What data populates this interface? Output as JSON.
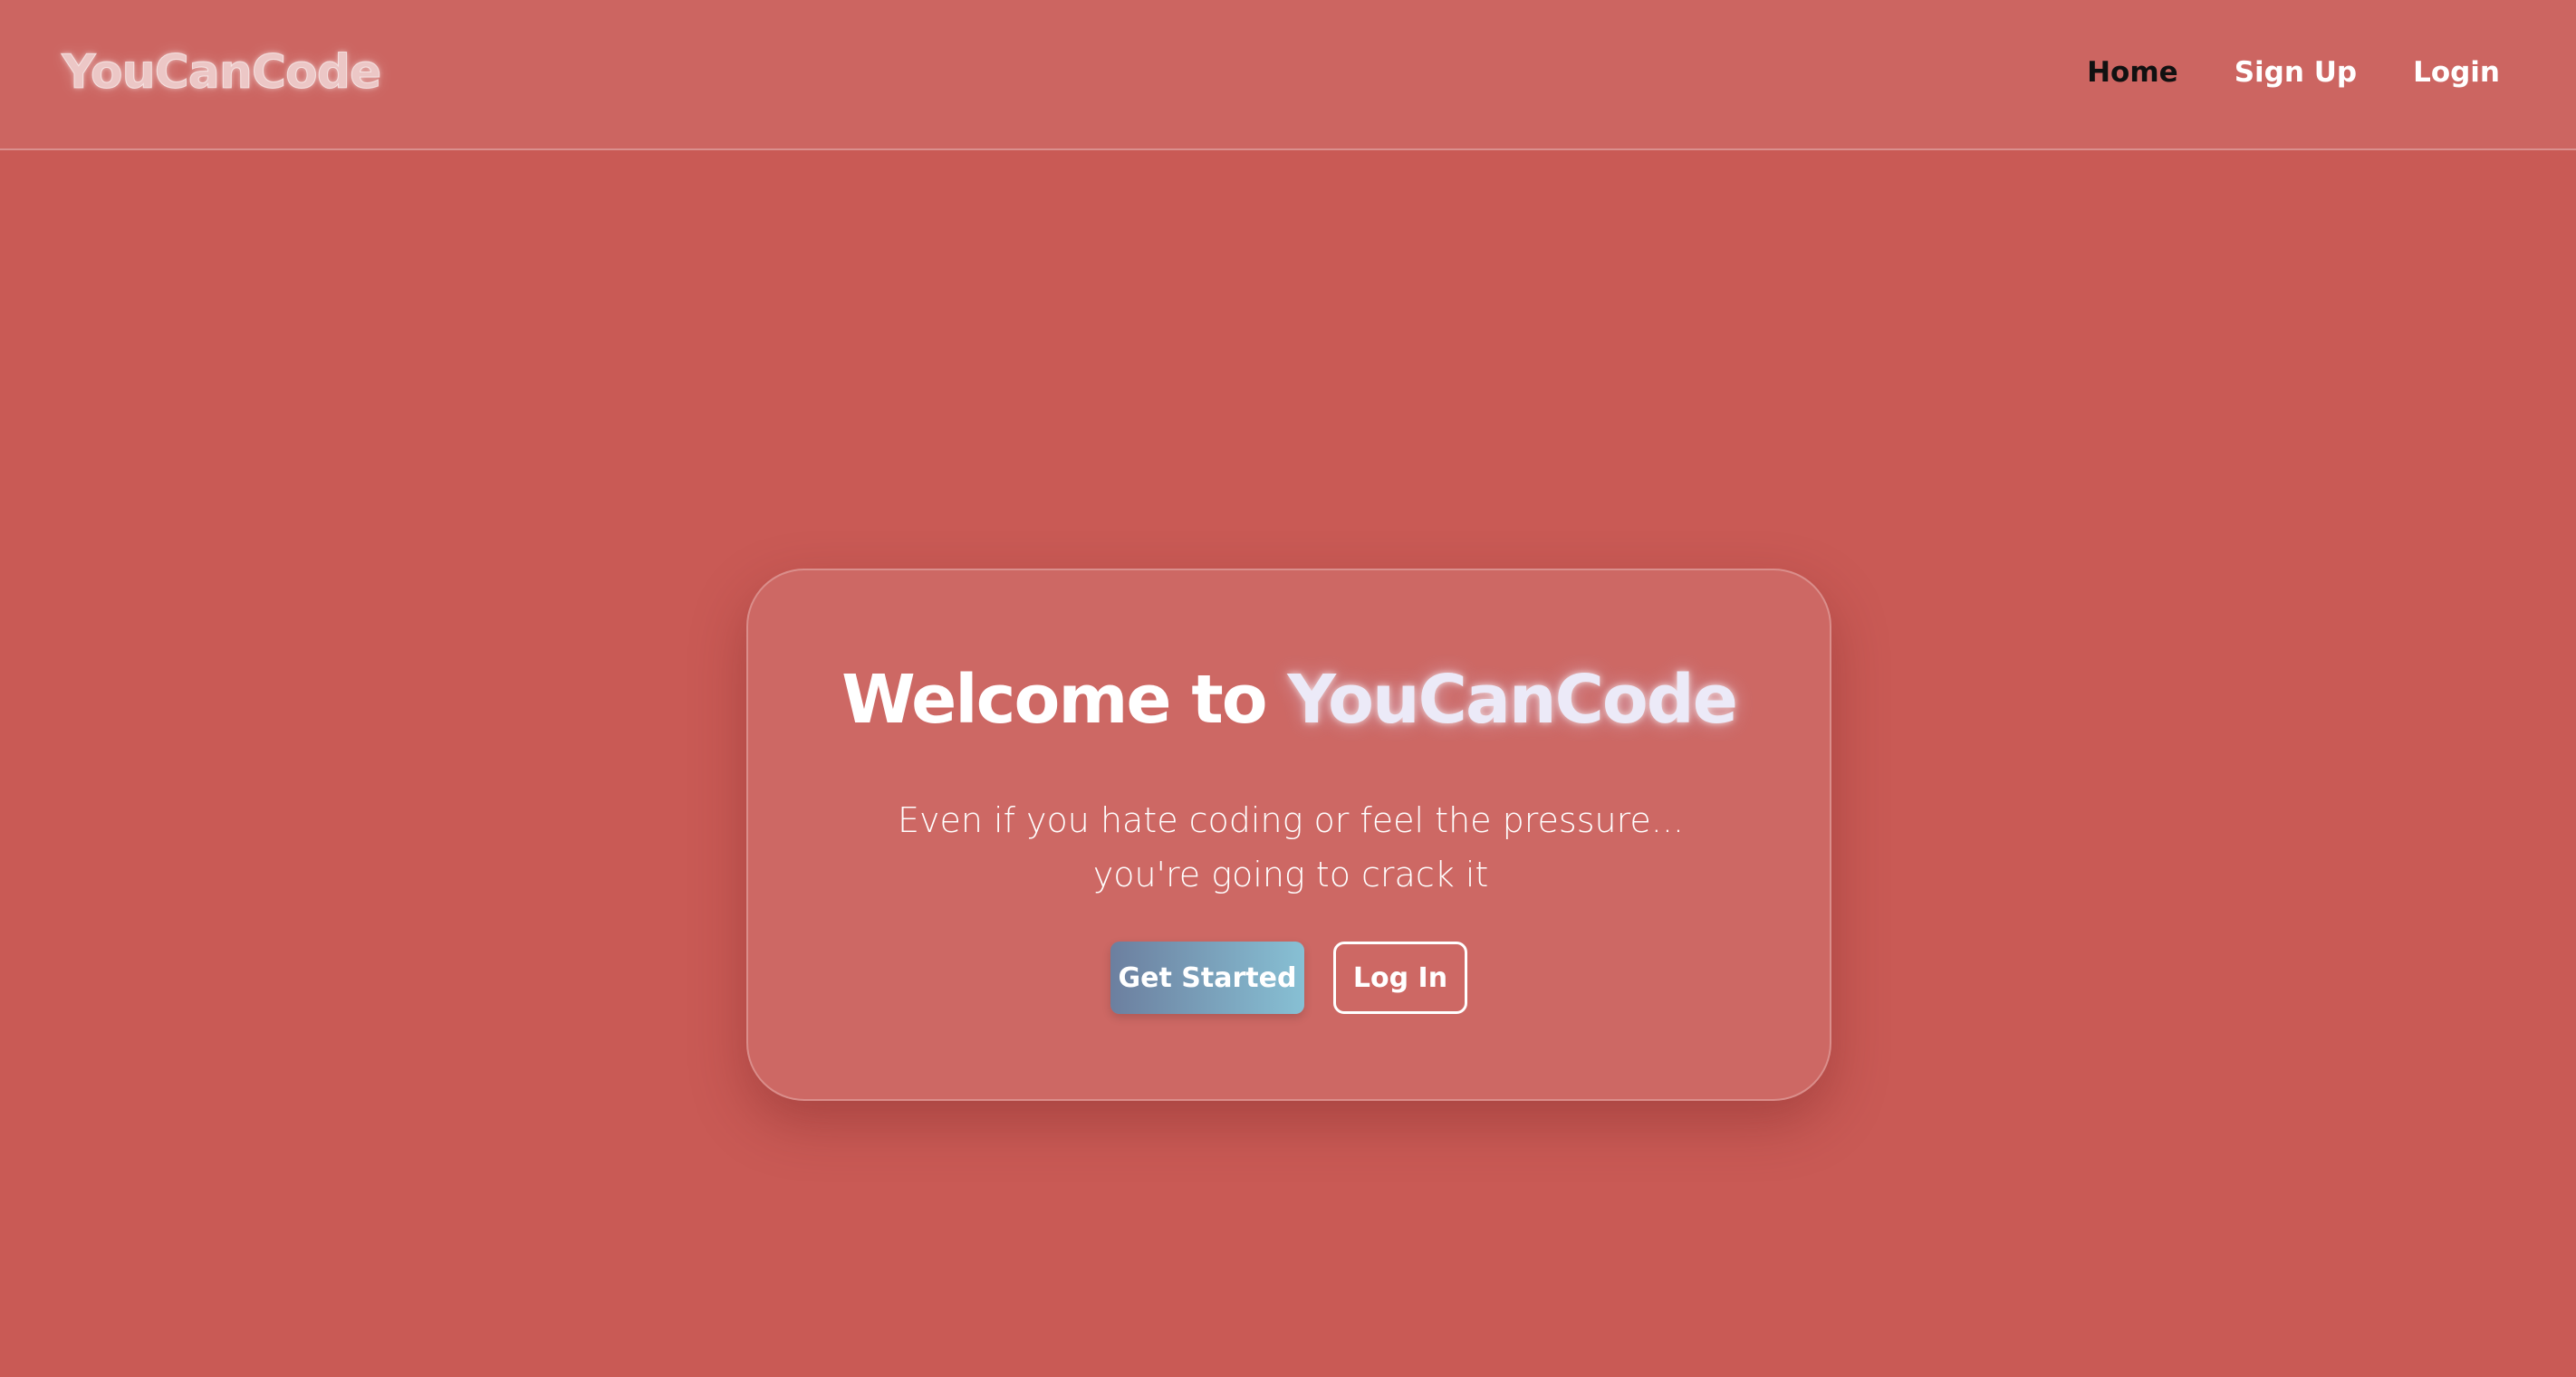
{
  "header": {
    "logo": "YouCanCode",
    "nav": [
      {
        "label": "Home",
        "active": true
      },
      {
        "label": "Sign Up",
        "active": false
      },
      {
        "label": "Login",
        "active": false
      }
    ]
  },
  "hero": {
    "title_prefix": "Welcome to ",
    "title_brand": "YouCanCode",
    "subtitle": "Even if you hate coding or feel the pressure... you're going to crack it",
    "primary_button": "Get Started",
    "secondary_button": "Log In"
  },
  "colors": {
    "background": "#c95a55",
    "button_gradient_start": "#6c7f9f",
    "button_gradient_end": "#87c0d4",
    "active_nav": "#111111"
  }
}
